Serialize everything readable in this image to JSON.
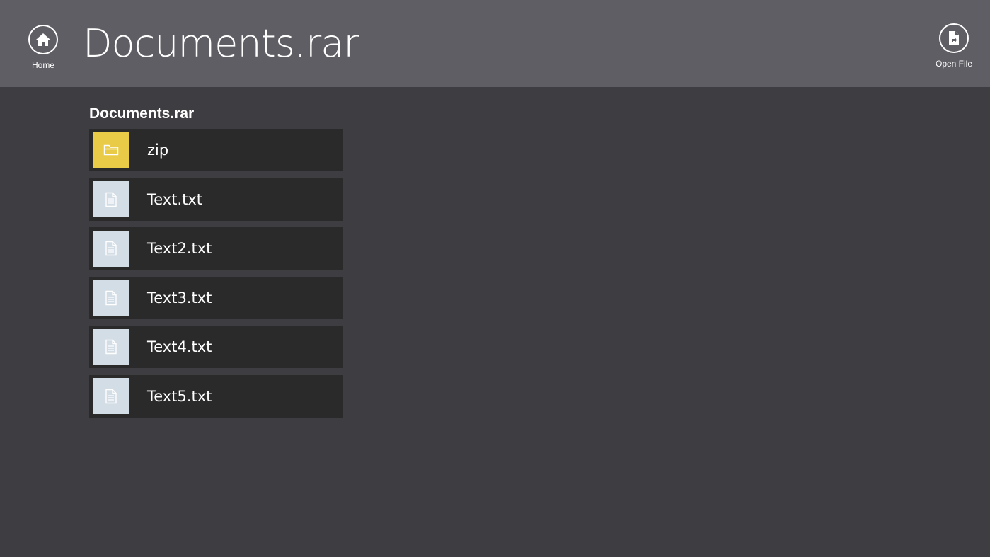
{
  "header": {
    "title": "Documents.rar",
    "home_label": "Home",
    "open_file_label": "Open File"
  },
  "archive": {
    "section_title": "Documents.rar",
    "items": [
      {
        "name": "zip",
        "type": "folder"
      },
      {
        "name": "Text.txt",
        "type": "text"
      },
      {
        "name": "Text2.txt",
        "type": "text"
      },
      {
        "name": "Text3.txt",
        "type": "text"
      },
      {
        "name": "Text4.txt",
        "type": "text"
      },
      {
        "name": "Text5.txt",
        "type": "text"
      }
    ]
  },
  "colors": {
    "header_bg": "#5f5e64",
    "page_bg": "#3e3d42",
    "item_bg": "#2a2a2b",
    "folder_tile": "#e9cb47",
    "text_tile": "#d3dde6"
  },
  "icons": {
    "home": "home-icon",
    "open_file": "open-file-icon",
    "folder": "folder-icon",
    "text_file": "text-file-icon"
  }
}
